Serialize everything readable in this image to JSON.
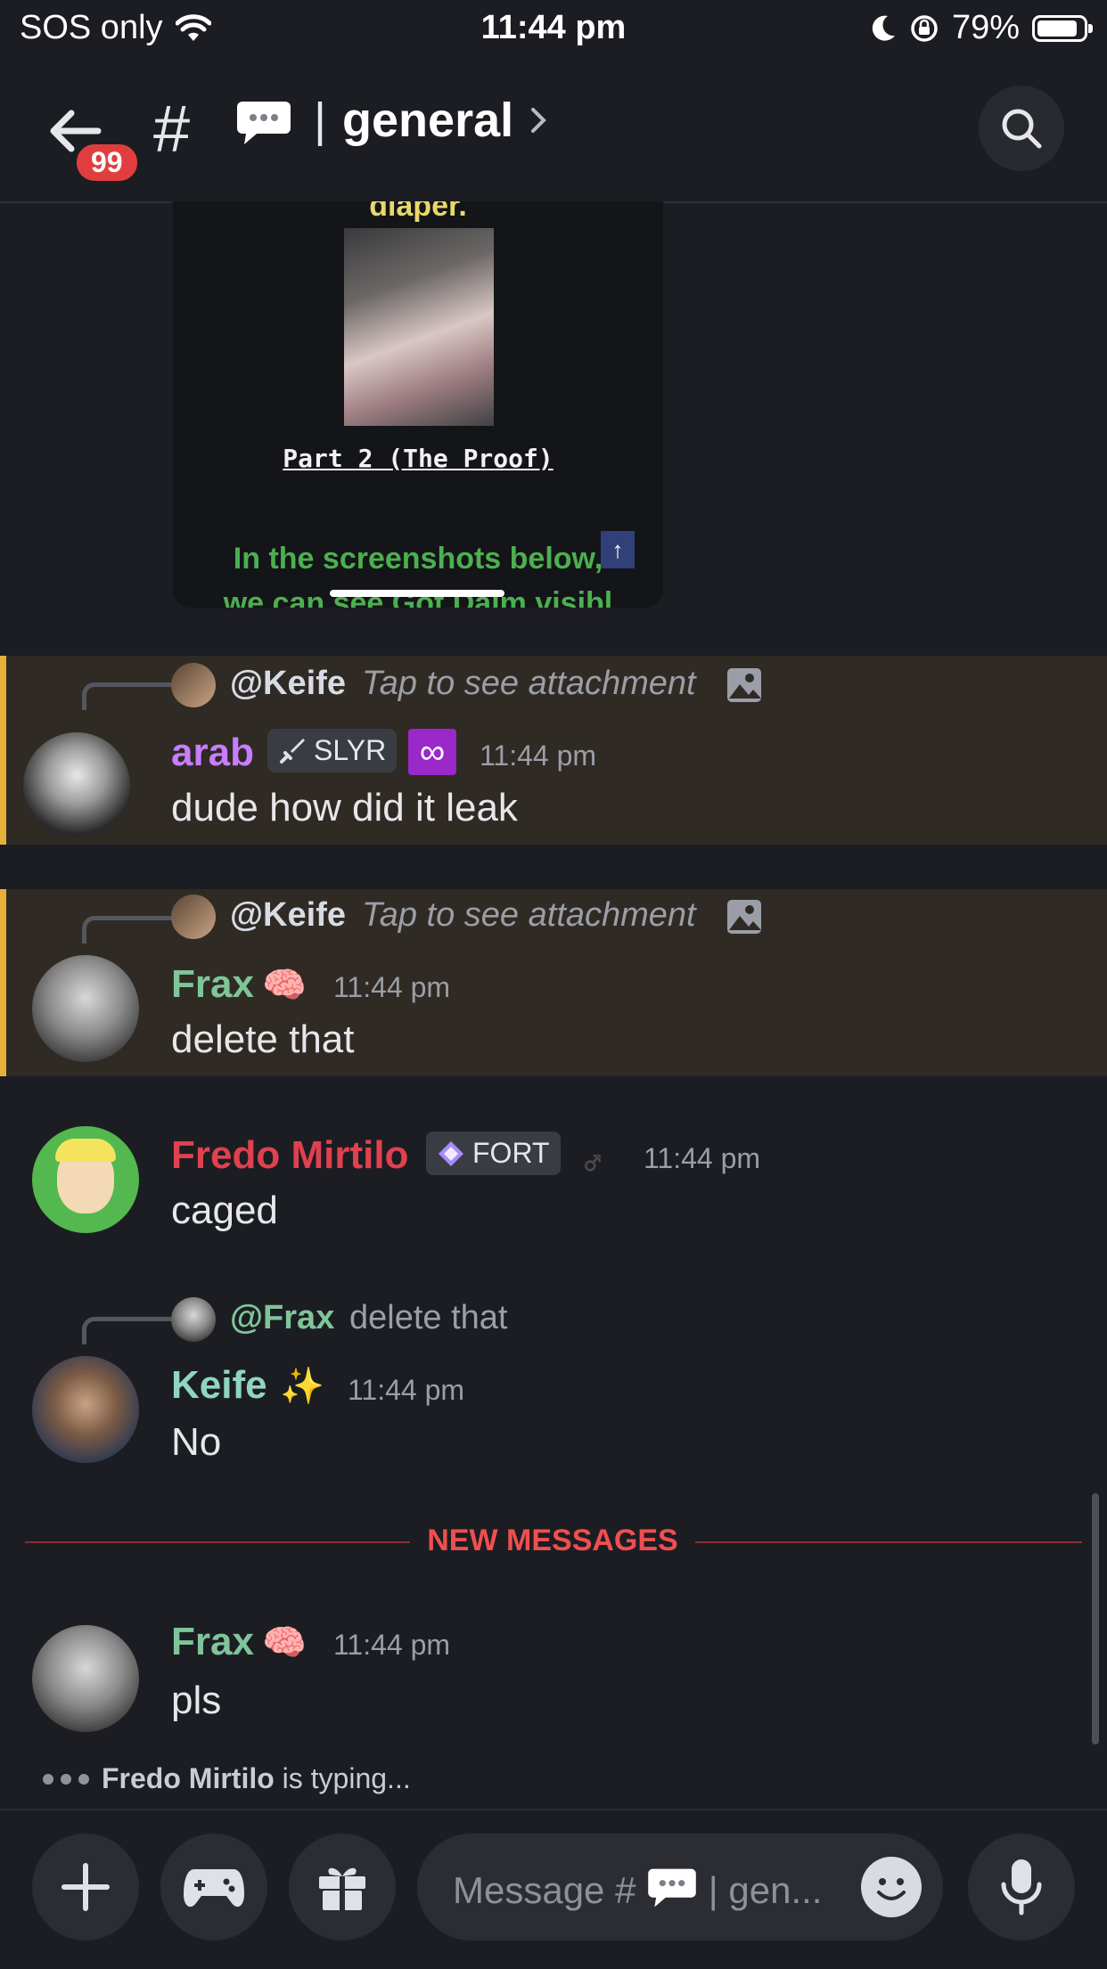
{
  "status_bar": {
    "carrier": "SOS only",
    "time": "11:44 pm",
    "battery": "79%"
  },
  "header": {
    "badge_count": "99",
    "hash": "#",
    "channel": "general",
    "divider": "|"
  },
  "embed": {
    "top_text": "diaper.",
    "part_label": "Part 2 (The Proof)",
    "green_text": "In the screenshots below,",
    "green_text_2": "we can see Got Daim visibl",
    "scroll_up": "↑"
  },
  "messages": [
    {
      "reply_to": "@Keife",
      "reply_text": "Tap to see attachment",
      "author": "arab",
      "author_color": "#c77dff",
      "tag": "SLYR",
      "tag_icon": "sword-icon",
      "time": "11:44 pm",
      "text": "dude how did it leak",
      "highlighted": true
    },
    {
      "reply_to": "@Keife",
      "reply_text": "Tap to see attachment",
      "author": "Frax",
      "author_color": "#7fc59a",
      "emoji": "🧠",
      "time": "11:44 pm",
      "text": "delete that",
      "highlighted": true
    },
    {
      "author": "Fredo Mirtilo",
      "author_color": "#e0414f",
      "tag": "FORT",
      "tag_icon": "diamond-icon",
      "gender": "♂",
      "time": "11:44 pm",
      "text": "caged"
    },
    {
      "reply_to": "@Frax",
      "reply_text": "delete that",
      "author": "Keife",
      "author_color": "#8fd6c0",
      "emoji": "✨",
      "time": "11:44 pm",
      "text": "No"
    },
    {
      "author": "Frax",
      "author_color": "#7fc59a",
      "emoji": "🧠",
      "time": "11:44 pm",
      "text": "pls"
    }
  ],
  "new_messages_label": "NEW MESSAGES",
  "typing": {
    "user": "Fredo Mirtilo",
    "suffix": "is typing..."
  },
  "composer": {
    "placeholder_start": "Message #",
    "placeholder_end": "| gen..."
  }
}
